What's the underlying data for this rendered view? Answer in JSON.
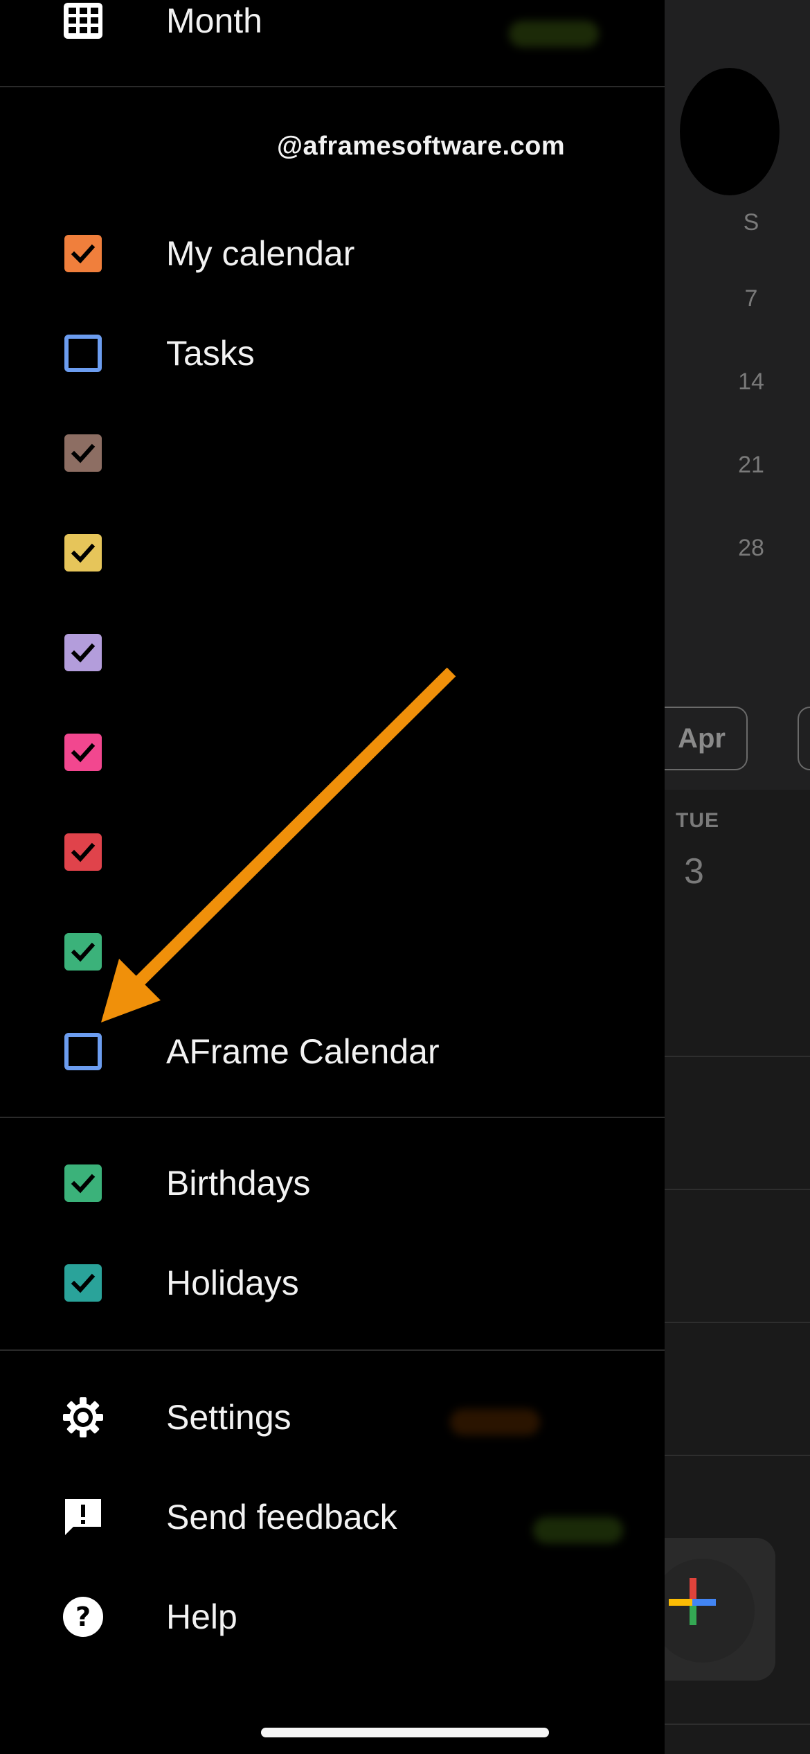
{
  "nav": {
    "month_label": "Month"
  },
  "account": {
    "email": "@aframesoftware.com"
  },
  "calendars": [
    {
      "label": "My calendar",
      "checked": true,
      "color": "#f07f3c"
    },
    {
      "label": "Tasks",
      "checked": false,
      "color": "#6c9df0"
    },
    {
      "label": "",
      "checked": true,
      "color": "#8d6e63"
    },
    {
      "label": "",
      "checked": true,
      "color": "#e6c55a"
    },
    {
      "label": "",
      "checked": true,
      "color": "#b39ddb"
    },
    {
      "label": "",
      "checked": true,
      "color": "#f2478f"
    },
    {
      "label": "",
      "checked": true,
      "color": "#e0434b"
    },
    {
      "label": "",
      "checked": true,
      "color": "#3bb27a"
    },
    {
      "label": "AFrame Calendar",
      "checked": false,
      "color": "#6c9df0"
    }
  ],
  "other_calendars": [
    {
      "label": "Birthdays",
      "checked": true,
      "color": "#3bb27a"
    },
    {
      "label": "Holidays",
      "checked": true,
      "color": "#2aa39a"
    }
  ],
  "footer": {
    "settings_label": "Settings",
    "feedback_label": "Send feedback",
    "help_label": "Help"
  },
  "background_calendar": {
    "day_of_week": "S",
    "dates": [
      "7",
      "14",
      "21",
      "28"
    ],
    "month_chip": "Apr",
    "day_label": "TUE",
    "day_number": "3"
  },
  "annotation": {
    "arrow_color": "#f0900a"
  }
}
